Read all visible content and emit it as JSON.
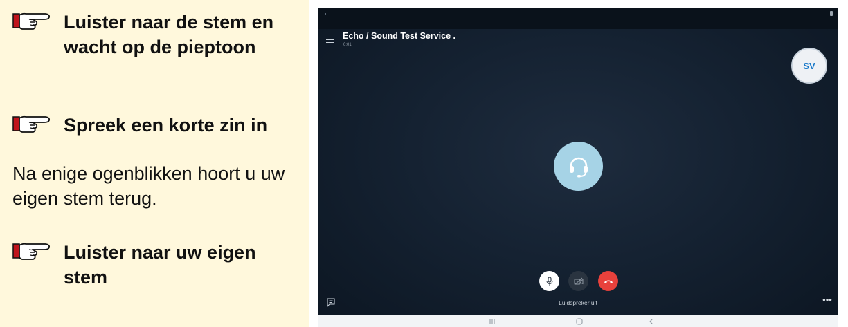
{
  "instructions": {
    "step1": "Luister naar de stem en wacht op de pieptoon",
    "step2": "Spreek een korte zin in",
    "info": "Na enige ogenblikken hoort u uw eigen stem terug.",
    "step3": "Luister naar uw eigen stem"
  },
  "call": {
    "title": "Echo / Sound Test Service .",
    "timer": "0:01",
    "avatar_initials": "SV",
    "speaker_label": "Luidspreker uit"
  },
  "colors": {
    "panel_background": "#fff8dc",
    "call_background": "#152232",
    "end_call": "#e8413c",
    "center_avatar": "#a6d3e6",
    "avatar_initials": "#1a79c9",
    "hand_cuff": "#c0141b"
  },
  "icons": {
    "step_marker": "pointing-hand-icon",
    "menu": "hamburger-menu-icon",
    "center": "headset-icon",
    "mic": "microphone-icon",
    "video": "video-off-icon",
    "end": "end-call-icon",
    "chat": "chat-icon",
    "more": "more-horizontal-icon",
    "nav_recent": "recent-apps-icon",
    "nav_home": "home-icon",
    "nav_back": "back-chevron-icon"
  }
}
